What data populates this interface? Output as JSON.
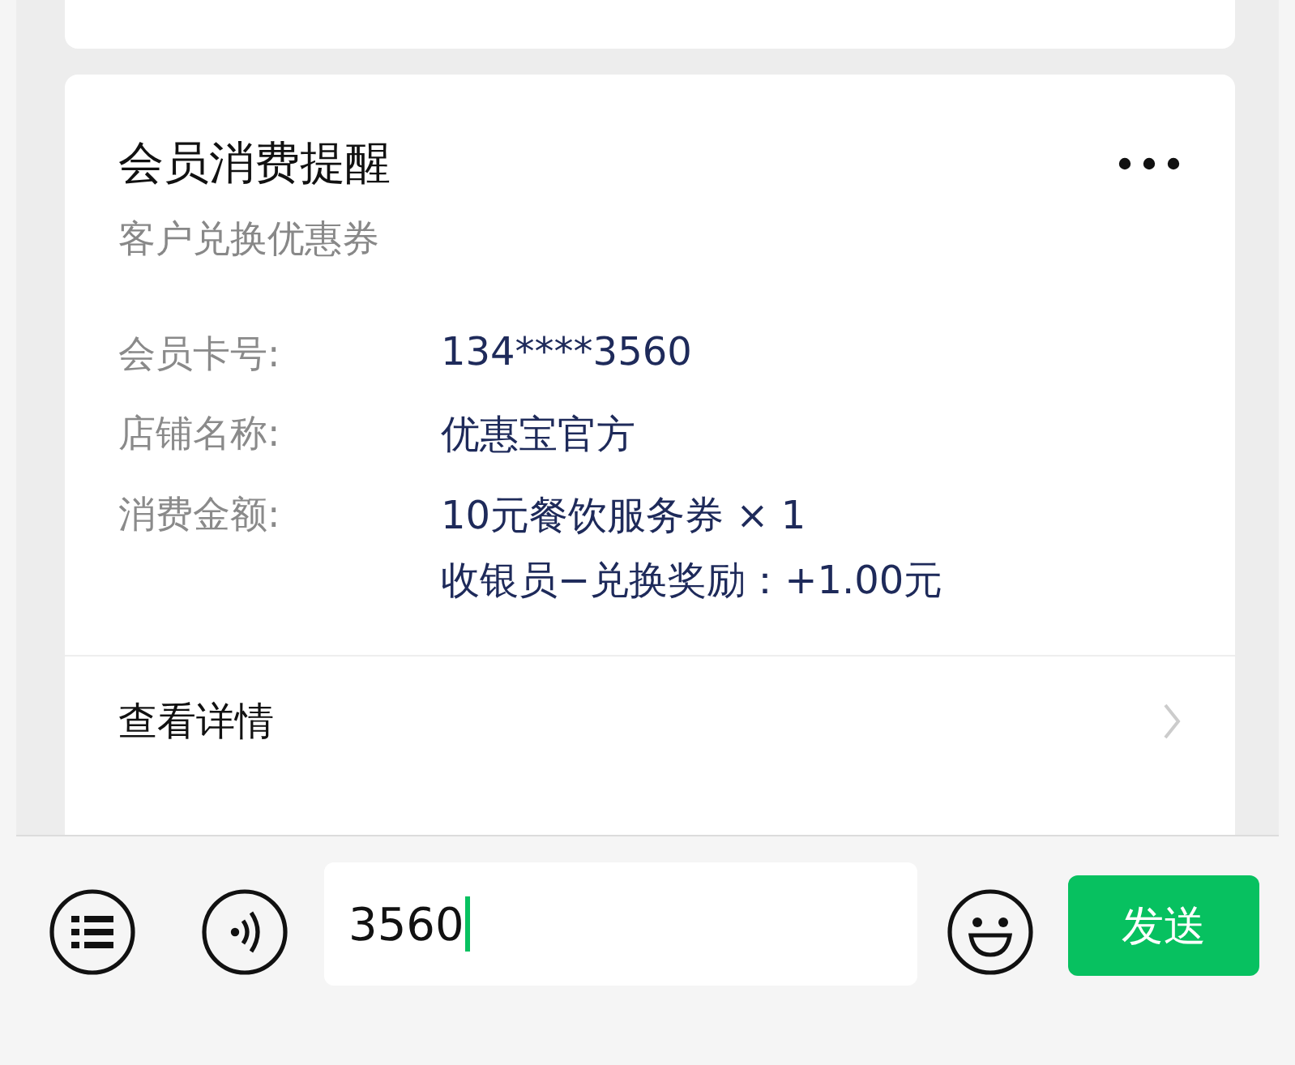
{
  "card": {
    "title": "会员消费提醒",
    "subtitle": "客户兑换优惠券",
    "rows": [
      {
        "label": "会员卡号:",
        "values": [
          "134****3560"
        ]
      },
      {
        "label": "店铺名称:",
        "values": [
          "优惠宝官方"
        ]
      },
      {
        "label": "消费金额:",
        "values": [
          "10元餐饮服务券 × 1",
          "收银员−兑换奖励：+1.00元"
        ]
      }
    ],
    "link": "查看详情"
  },
  "composer": {
    "value": "3560",
    "send": "发送"
  }
}
